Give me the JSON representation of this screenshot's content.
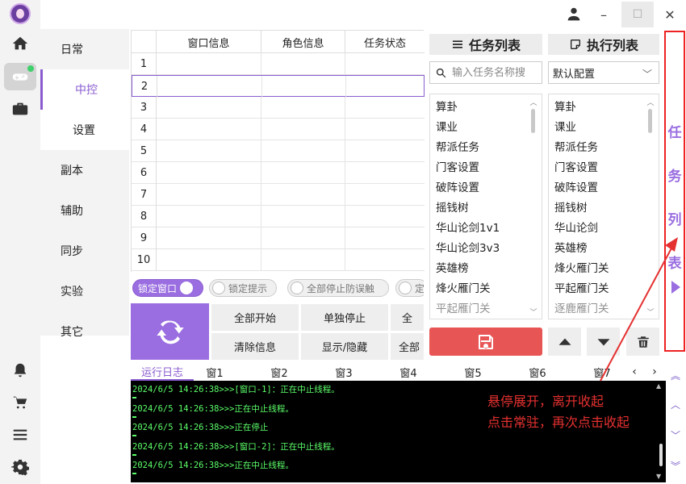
{
  "nav": {
    "items": [
      {
        "label": "日常"
      },
      {
        "label": "中控"
      },
      {
        "label": "设置"
      },
      {
        "label": "副本"
      },
      {
        "label": "辅助"
      },
      {
        "label": "同步"
      },
      {
        "label": "实验"
      },
      {
        "label": "其它"
      }
    ]
  },
  "window_controls": {
    "minimize": "–",
    "maximize": "☐",
    "close": "✕"
  },
  "window_table": {
    "columns": [
      "窗口信息",
      "角色信息",
      "任务状态"
    ],
    "row_numbers": [
      "1",
      "2",
      "3",
      "4",
      "5",
      "6",
      "7",
      "8",
      "9",
      "10"
    ]
  },
  "toggles": [
    {
      "label": "锁定窗口",
      "on": true
    },
    {
      "label": "锁定提示",
      "on": false
    },
    {
      "label": "全部停止防误触",
      "on": false
    },
    {
      "label": "定",
      "on": false
    }
  ],
  "actions": {
    "row1": [
      "全部开始",
      "单独停止",
      "全"
    ],
    "row2": [
      "清除信息",
      "显示/隐藏",
      "全部"
    ]
  },
  "log_tabs": [
    "运行日志",
    "窗1",
    "窗2",
    "窗3",
    "窗4",
    "窗5",
    "窗6",
    "窗7"
  ],
  "log_tab_nav": {
    "prev": "‹",
    "next": "›"
  },
  "log_lines": [
    "2024/6/5 14:26:38>>>[窗口-1]：正在中止线程。",
    "2024/6/5 14:26:38>>>正在中止线程。",
    "2024/6/5 14:26:38>>>正在停止",
    "2024/6/5 14:26:38>>>[窗口-2]：正在中止线程。",
    "2024/6/5 14:26:38>>>正在中止线程。"
  ],
  "annotation": {
    "line1": "悬停展开，离开收起",
    "line2": "点击常驻，再次点击收起"
  },
  "task_list": {
    "title": "任务列表",
    "search_placeholder": "输入任务名称搜",
    "items": [
      "算卦",
      "课业",
      "帮派任务",
      "门客设置",
      "破阵设置",
      "摇钱树",
      "华山论剑1v1",
      "华山论剑3v3",
      "英雄榜",
      "烽火雁门关",
      "平起雁门关"
    ]
  },
  "exec_list": {
    "title": "执行列表",
    "config_selected": "默认配置",
    "items": [
      "算卦",
      "课业",
      "帮派任务",
      "门客设置",
      "破阵设置",
      "摇钱树",
      "华山论剑",
      "英雄榜",
      "烽火雁门关",
      "平起雁门关",
      "逐鹿雁门关"
    ]
  },
  "drawer": {
    "chars": [
      "任",
      "务",
      "列",
      "表"
    ]
  },
  "colors": {
    "accent": "#9a6ee0",
    "save": "#e85555",
    "highlight_border": "#ee2222",
    "log_text": "#5cff6a"
  }
}
